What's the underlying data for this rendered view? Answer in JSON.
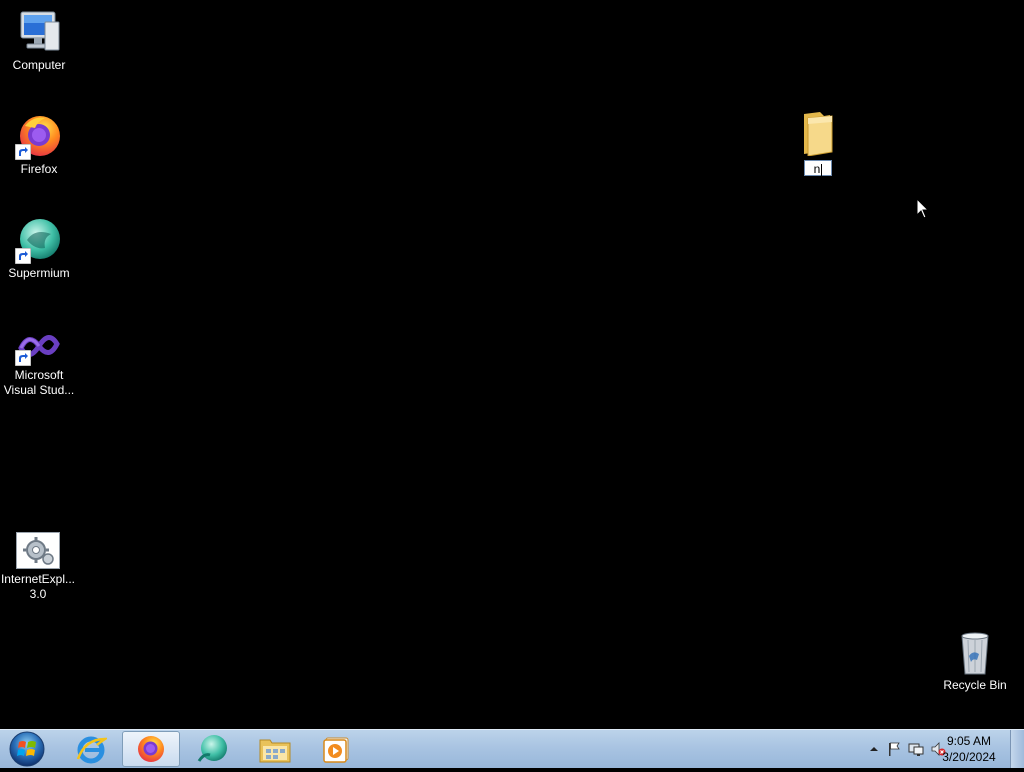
{
  "desktop": {
    "icons": [
      {
        "label": "Computer",
        "icon": "computer-icon"
      },
      {
        "label": "Firefox",
        "icon": "firefox-icon"
      },
      {
        "label": "Supermium",
        "icon": "supermium-icon"
      },
      {
        "label": "Microsoft\nVisual Stud...",
        "icon": "visual-studio-icon"
      },
      {
        "label": "InternetExpl...\n3.0",
        "icon": "internet-explorer-setup-icon"
      },
      {
        "label": "Recycle Bin",
        "icon": "recycle-bin-icon"
      }
    ],
    "new_folder": {
      "icon": "folder-icon",
      "rename_value": "n"
    }
  },
  "taskbar": {
    "start": "windows-start-orb",
    "pinned": [
      {
        "name": "internet-explorer",
        "icon": "internet-explorer-icon",
        "active": false
      },
      {
        "name": "firefox",
        "icon": "firefox-icon",
        "active": true
      },
      {
        "name": "supermium",
        "icon": "supermium-icon",
        "active": false
      },
      {
        "name": "file-explorer",
        "icon": "file-explorer-icon",
        "active": false
      },
      {
        "name": "media-player",
        "icon": "media-player-icon",
        "active": false
      }
    ],
    "tray": {
      "icons": [
        "show-hidden-icons-arrow",
        "action-center-flag-icon",
        "network-icon",
        "volume-muted-icon"
      ],
      "time": "9:05 AM",
      "date": "3/20/2024"
    }
  },
  "colors": {
    "desktop_bg": "#000000",
    "taskbar_top": "#bcd3ea",
    "taskbar_bottom": "#98b7da"
  }
}
